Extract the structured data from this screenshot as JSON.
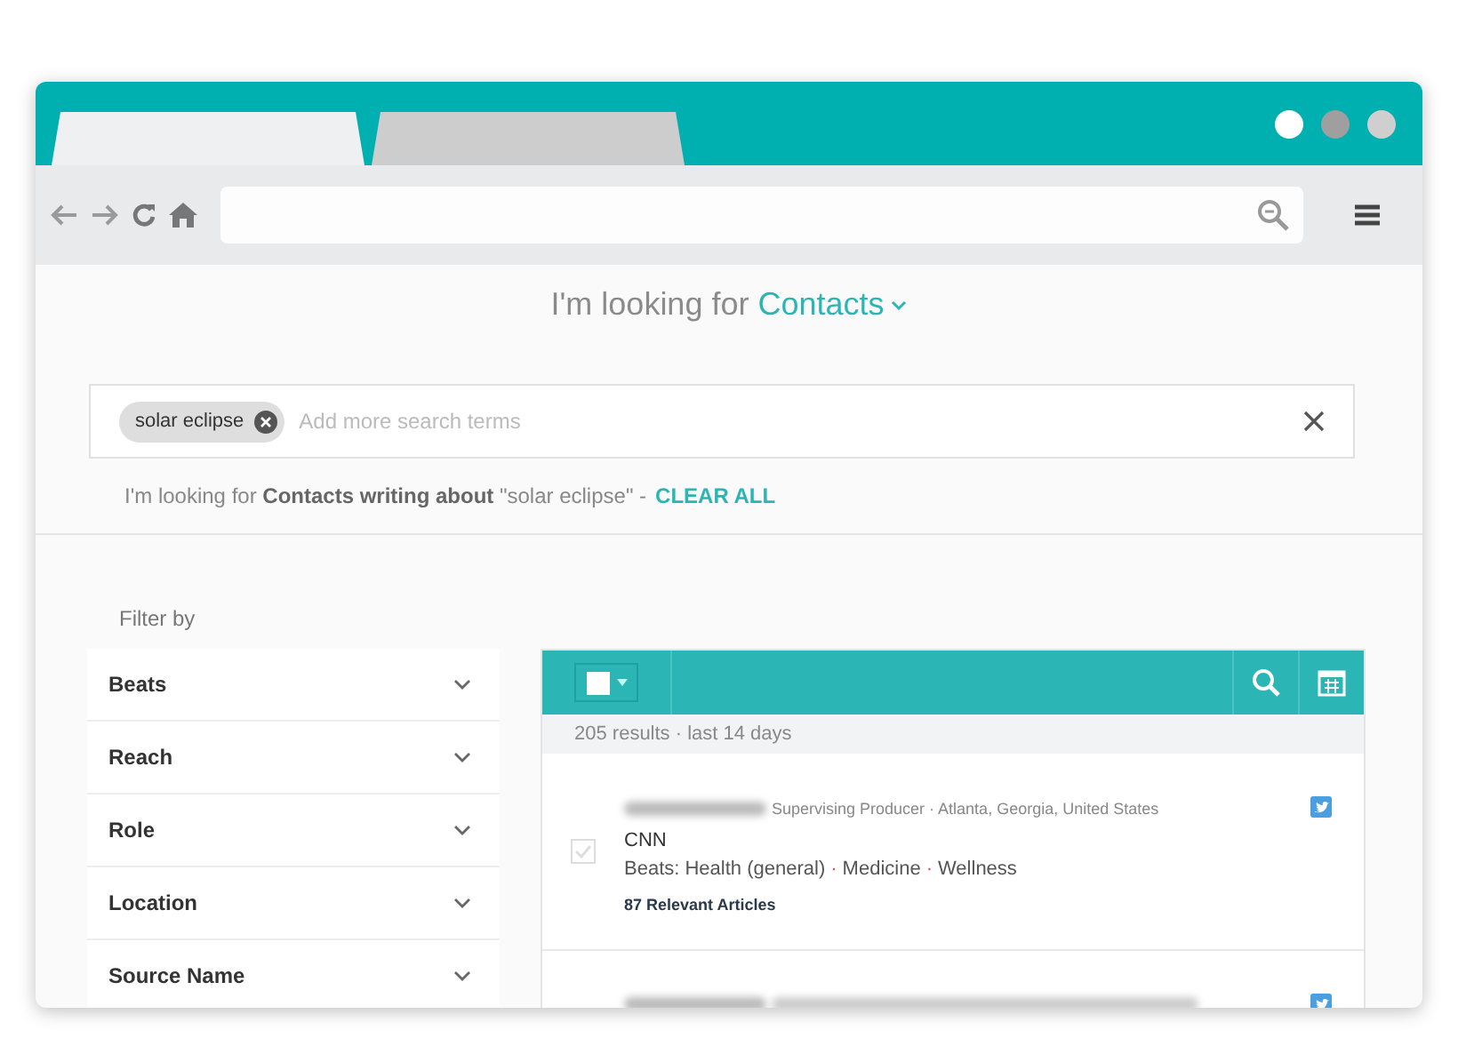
{
  "browser": {
    "tabs": [
      {
        "selected": true
      },
      {
        "selected": false
      }
    ]
  },
  "heading": {
    "prefix": "I'm looking for",
    "entity": "Contacts"
  },
  "search": {
    "chips": [
      "solar eclipse"
    ],
    "placeholder": "Add more search terms"
  },
  "summary": {
    "text": "I'm looking for **Contacts writing about** \"solar eclipse\" -",
    "clear": "CLEAR ALL"
  },
  "filters": {
    "title": "Filter by",
    "items": [
      "Beats",
      "Reach",
      "Role",
      "Location",
      "Source Name"
    ]
  },
  "results": {
    "count": "205 results · last 14 days",
    "separator": "·",
    "rows": [
      {
        "role": "Supervising Producer · Atlanta, Georgia, United States",
        "outlet": "CNN",
        "beats": [
          "Beats: Health (general)",
          "Medicine",
          "Wellness"
        ],
        "articles": "87 Relevant Articles",
        "checked": false
      },
      {}
    ]
  }
}
